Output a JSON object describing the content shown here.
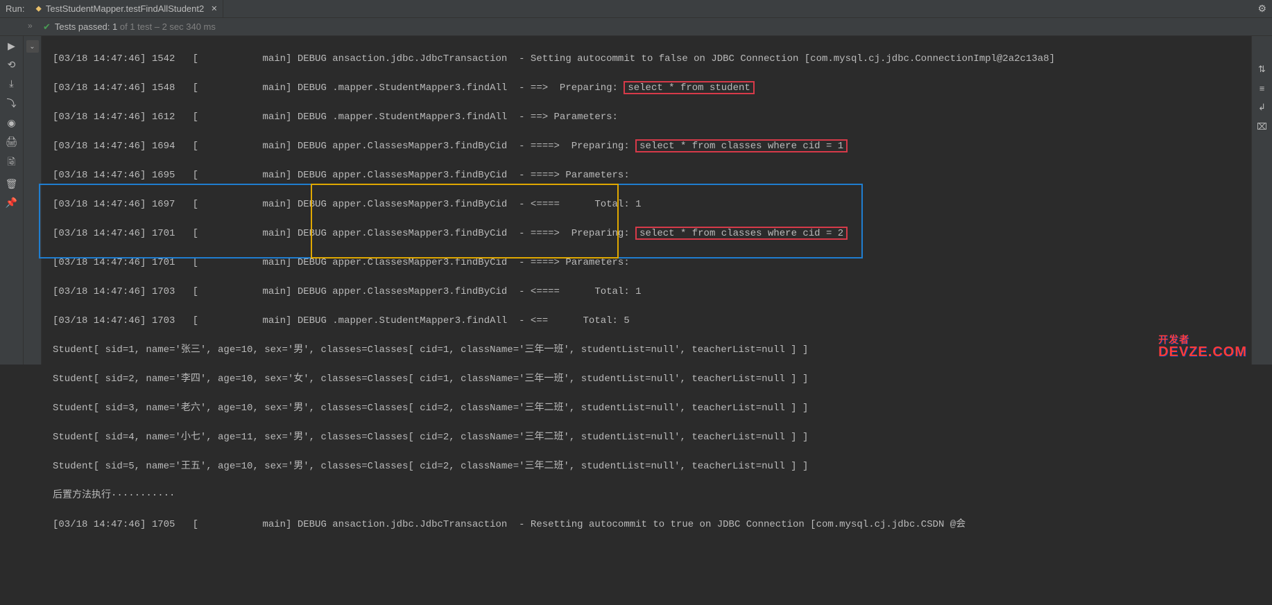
{
  "header": {
    "run_label": "Run:",
    "tab_title": "TestStudentMapper.testFindAllStudent2",
    "gear_icon": "⚙"
  },
  "status": {
    "check": "✔",
    "prefix": "Tests passed: ",
    "passed": "1",
    "suffix": " of 1 test – 2 sec 340 ms"
  },
  "left_icons": [
    "▶",
    "⟲",
    "⤓",
    "⤵",
    "◉",
    "🖨",
    "🗟",
    "🗑",
    "📌"
  ],
  "second_col": {
    "arrow": "⌄",
    "chevrons": "»"
  },
  "right_icons": [
    "⇅",
    "≡",
    "↲",
    "⌧"
  ],
  "lines": [
    "[03/18 14:47:46] 1542   [           main] DEBUG ansaction.jdbc.JdbcTransaction  - Setting autocommit to false on JDBC Connection [com.mysql.cj.jdbc.ConnectionImpl@2a2c13a8]",
    "[03/18 14:47:46] 1548   [           main] DEBUG .mapper.StudentMapper3.findAll  - ==>  Preparing: ",
    "[03/18 14:47:46] 1612   [           main] DEBUG .mapper.StudentMapper3.findAll  - ==> Parameters: ",
    "[03/18 14:47:46] 1694   [           main] DEBUG apper.ClassesMapper3.findByCid  - ====>  Preparing: ",
    "[03/18 14:47:46] 1695   [           main] DEBUG apper.ClassesMapper3.findByCid  - ====> Parameters: ",
    "[03/18 14:47:46] 1697   [           main] DEBUG apper.ClassesMapper3.findByCid  - <====      Total: 1",
    "[03/18 14:47:46] 1701   [           main] DEBUG apper.ClassesMapper3.findByCid  - ====>  Preparing: ",
    "[03/18 14:47:46] 1701   [           main] DEBUG apper.ClassesMapper3.findByCid  - ====> Parameters: ",
    "[03/18 14:47:46] 1703   [           main] DEBUG apper.ClassesMapper3.findByCid  - <====      Total: 1",
    "[03/18 14:47:46] 1703   [           main] DEBUG .mapper.StudentMapper3.findAll  - <==      Total: 5",
    "Student[ sid=1, name='张三', age=10, sex='男', classes=Classes[ cid=1, className='三年一班', studentList=null', teacherList=null ] ]",
    "Student[ sid=2, name='李四', age=10, sex='女', classes=Classes[ cid=1, className='三年一班', studentList=null', teacherList=null ] ]",
    "Student[ sid=3, name='老六', age=10, sex='男', classes=Classes[ cid=2, className='三年二班', studentList=null', teacherList=null ] ]",
    "Student[ sid=4, name='小七', age=11, sex='男', classes=Classes[ cid=2, className='三年二班', studentList=null', teacherList=null ] ]",
    "Student[ sid=5, name='王五', age=10, sex='男', classes=Classes[ cid=2, className='三年二班', studentList=null', teacherList=null ] ]",
    "后置方法执行···········",
    "[03/18 14:47:46] 1705   [           main] DEBUG ansaction.jdbc.JdbcTransaction  - Resetting autocommit to true on JDBC Connection [com.mysql.cj.jdbc.CSDN @会"
  ],
  "sql": {
    "q1": "select * from student",
    "q2": "select * from classes where cid = 1",
    "q3": "select * from classes where cid = 2"
  },
  "watermark": {
    "cn": "开发者",
    "en": "DEVZE.COM"
  }
}
